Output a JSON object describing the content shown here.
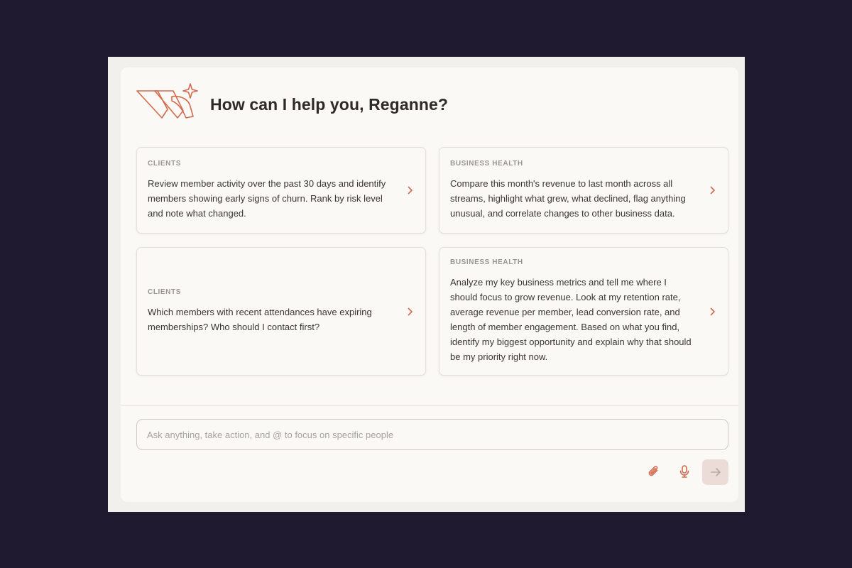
{
  "greeting": "How can I help you, Reganne?",
  "colors": {
    "accent": "#d26a4e",
    "background": "#201a30",
    "panel": "#faf9f6"
  },
  "logo": {
    "icon": "sparkle-w-logo-icon"
  },
  "cards": [
    {
      "category": "CLIENTS",
      "text": "Review member activity over the past 30 days and identify members showing early signs of churn. Rank by risk level and note what changed.",
      "icon": "chevron-right-icon"
    },
    {
      "category": "BUSINESS HEALTH",
      "text": "Compare this month's revenue to last month across all streams, highlight what grew, what declined, flag anything unusual, and correlate changes to other business data.",
      "icon": "chevron-right-icon"
    },
    {
      "category": "CLIENTS",
      "text": "Which members with recent attendances have expiring memberships? Who should I contact first?",
      "icon": "chevron-right-icon"
    },
    {
      "category": "BUSINESS HEALTH",
      "text": "Analyze my key business metrics and tell me where I should focus to grow revenue. Look at my retention rate, average revenue per member, lead conversion rate, and length of member engagement. Based on what you find, identify my biggest opportunity and explain why that should be my priority right now.",
      "icon": "chevron-right-icon"
    }
  ],
  "composer": {
    "placeholder": "Ask anything, take action, and @ to focus on specific people",
    "value": "",
    "attach_icon": "paperclip-icon",
    "mic_icon": "microphone-icon",
    "send_icon": "arrow-right-icon"
  }
}
